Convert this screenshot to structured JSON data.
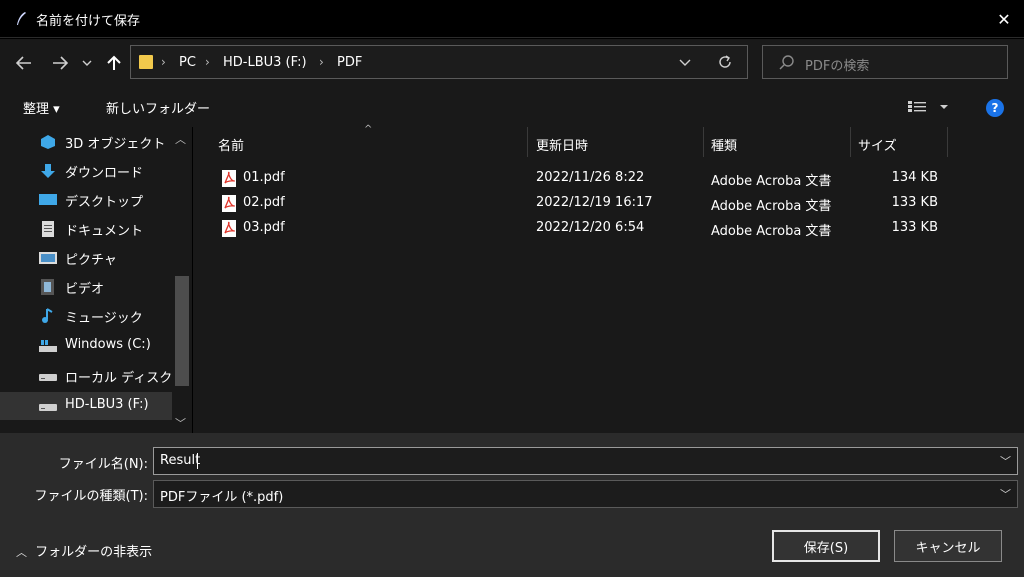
{
  "window": {
    "title": "名前を付けて保存",
    "close_glyph": "✕"
  },
  "nav": {
    "breadcrumbs": [
      "PC",
      "HD-LBU3 (F:)",
      "PDF"
    ],
    "search_placeholder": "PDFの検索"
  },
  "toolbar": {
    "organize": "整理 ▾",
    "new_folder": "新しいフォルダー",
    "help": "?"
  },
  "sidebar": {
    "items": [
      {
        "label": "3D オブジェクト",
        "icon": "cube-3d-icon"
      },
      {
        "label": "ダウンロード",
        "icon": "download-arrow-icon"
      },
      {
        "label": "デスクトップ",
        "icon": "desktop-icon"
      },
      {
        "label": "ドキュメント",
        "icon": "document-icon"
      },
      {
        "label": "ピクチャ",
        "icon": "pictures-icon"
      },
      {
        "label": "ビデオ",
        "icon": "video-icon"
      },
      {
        "label": "ミュージック",
        "icon": "music-note-icon"
      },
      {
        "label": "Windows (C:)",
        "icon": "windows-drive-icon"
      },
      {
        "label": "ローカル ディスク (D",
        "icon": "drive-icon"
      },
      {
        "label": "HD-LBU3 (F:)",
        "icon": "drive-icon",
        "selected": true
      }
    ]
  },
  "columns": {
    "name": "名前",
    "date": "更新日時",
    "type": "種類",
    "size": "サイズ"
  },
  "files": [
    {
      "name": "01.pdf",
      "date": "2022/11/26 8:22",
      "type": "Adobe Acroba 文書",
      "size": "134 KB"
    },
    {
      "name": "02.pdf",
      "date": "2022/12/19 16:17",
      "type": "Adobe Acroba 文書",
      "size": "133 KB"
    },
    {
      "name": "03.pdf",
      "date": "2022/12/20 6:54",
      "type": "Adobe Acroba 文書",
      "size": "133 KB"
    }
  ],
  "form": {
    "filename_label": "ファイル名(N):",
    "filename_value": "Result",
    "filetype_label": "ファイルの種類(T):",
    "filetype_value": "PDFファイル (*.pdf)"
  },
  "footer": {
    "hide_folders": "フォルダーの非表示",
    "save": "保存(S)",
    "cancel": "キャンセル"
  },
  "colors": {
    "accent": "#1a73e8",
    "pdf_red": "#e0362c",
    "folder_yellow": "#f2c94c"
  }
}
